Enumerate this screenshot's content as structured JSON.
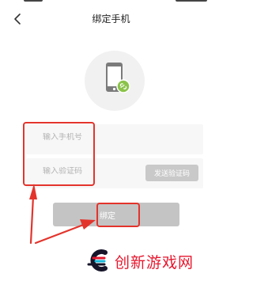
{
  "header": {
    "title": "绑定手机"
  },
  "form": {
    "phone_placeholder": "输入手机号",
    "code_placeholder": "输入验证码",
    "send_code_label": "发送验证码",
    "bind_label": "绑定"
  },
  "watermark": {
    "text": "创新游戏网"
  },
  "colors": {
    "annotation": "#e3342c",
    "accent_green": "#8bc34a",
    "button_gray": "#c4c4c4"
  }
}
